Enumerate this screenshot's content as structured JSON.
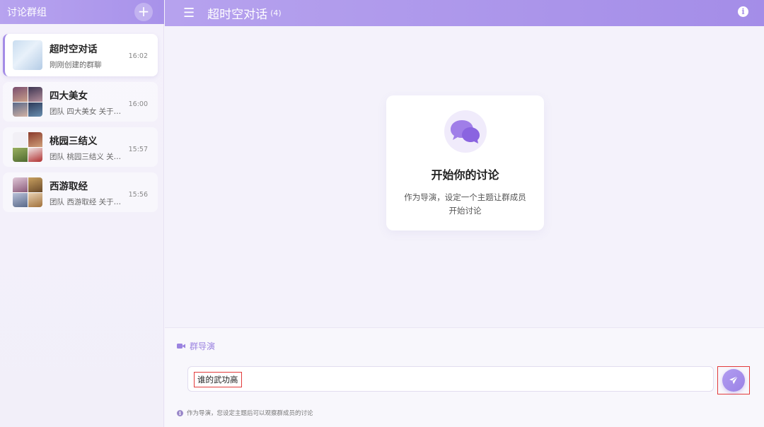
{
  "sidebar": {
    "title": "讨论群组",
    "add_label": "+",
    "items": [
      {
        "name": "超时空对话",
        "preview": "刚刚创建的群聊",
        "time": "16:02",
        "active": true
      },
      {
        "name": "四大美女",
        "preview": "团队 四大美女 关于…",
        "time": "16:00",
        "active": false
      },
      {
        "name": "桃园三结义",
        "preview": "团队 桃园三结义 关…",
        "time": "15:57",
        "active": false
      },
      {
        "name": "西游取经",
        "preview": "团队 西游取经 关于…",
        "time": "15:56",
        "active": false
      }
    ]
  },
  "header": {
    "menu_icon": "☰",
    "title": "超时空对话",
    "member_count": "(4)",
    "info_icon": "i"
  },
  "empty_state": {
    "icon": "chat-bubbles-icon",
    "title": "开始你的讨论",
    "description": "作为导演，设定一个主题让群成员开始讨论"
  },
  "composer": {
    "role_label": "群导演",
    "input_value": "谁的武功高",
    "hint_icon": "i",
    "hint": "作为导演，您设定主题后可以观察群成员的讨论"
  },
  "colors": {
    "accent": "#a48de8",
    "highlight_border": "#e23b3b"
  }
}
